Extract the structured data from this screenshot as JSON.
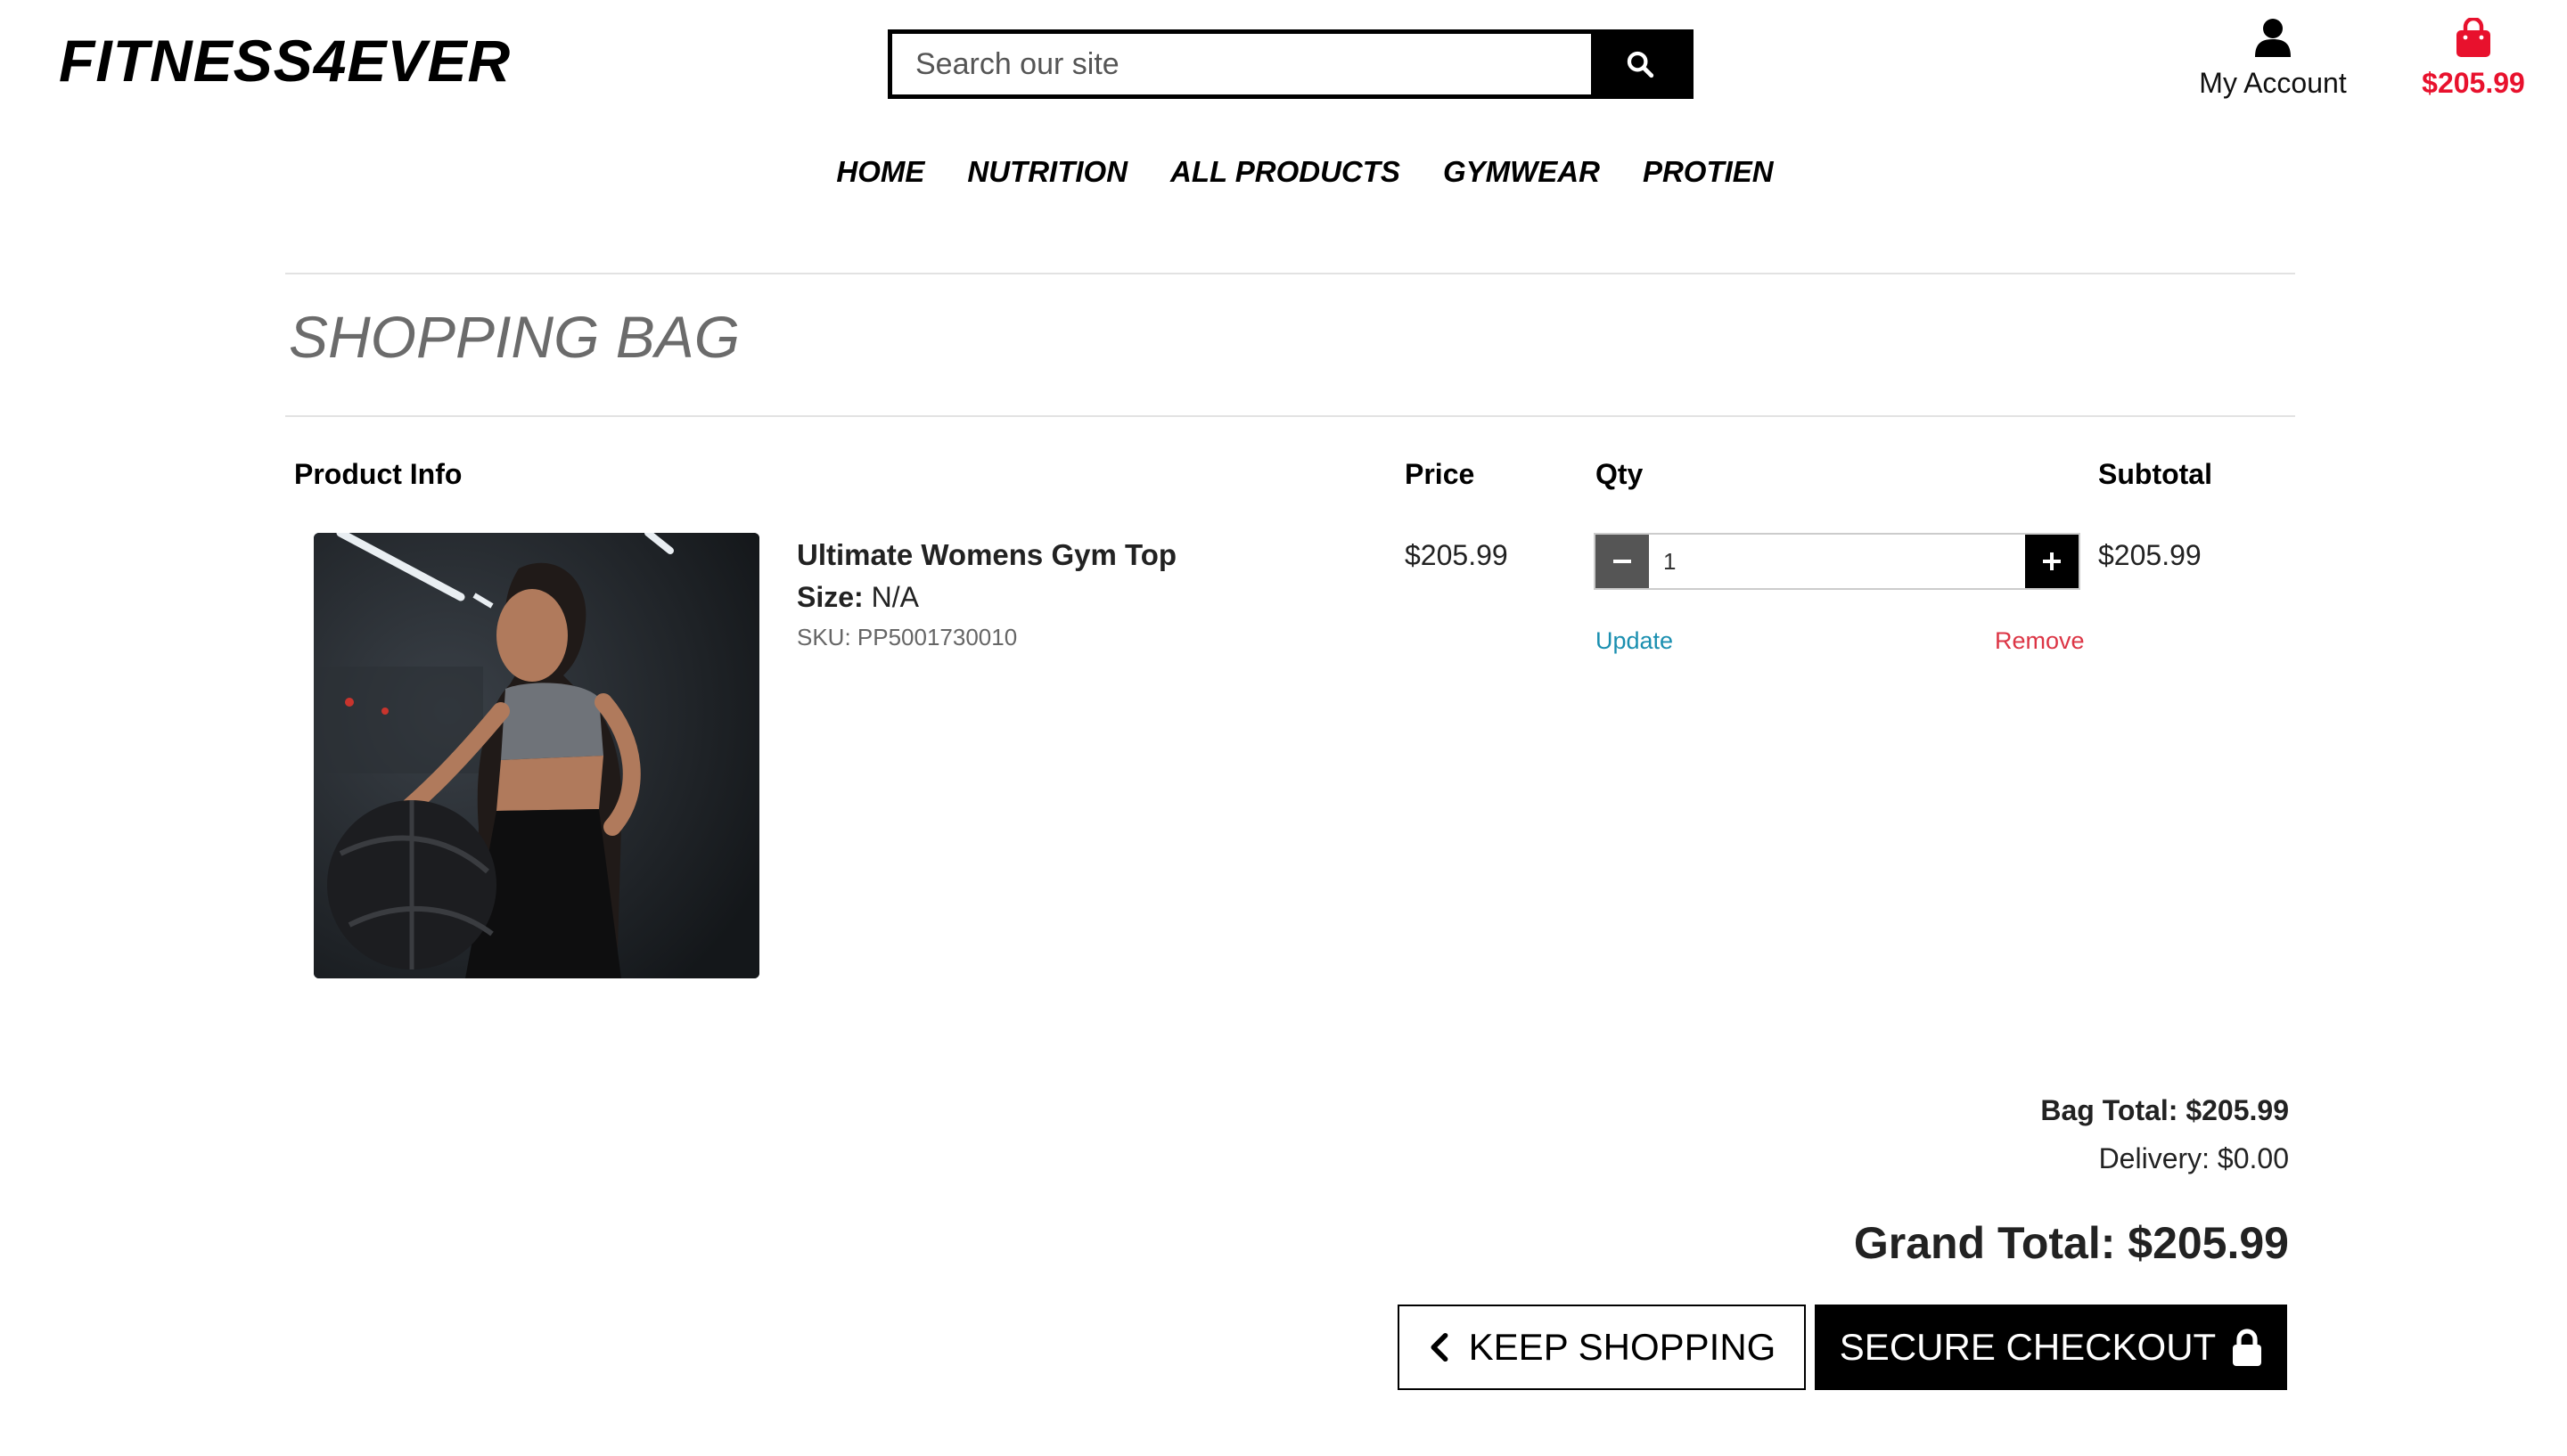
{
  "header": {
    "logo": "FITNESS4EVER",
    "search_placeholder": "Search our site",
    "account_label": "My Account",
    "bag_total": "$205.99"
  },
  "nav": {
    "items": [
      "HOME",
      "NUTRITION",
      "ALL PRODUCTS",
      "GYMWEAR",
      "PROTIEN"
    ]
  },
  "page": {
    "title": "SHOPPING BAG"
  },
  "table": {
    "headers": {
      "product": "Product Info",
      "price": "Price",
      "qty": "Qty",
      "subtotal": "Subtotal"
    }
  },
  "item": {
    "name": "Ultimate Womens Gym Top",
    "size_label": "Size:",
    "size_value": "N/A",
    "sku": "SKU: PP5001730010",
    "price": "$205.99",
    "quantity": "1",
    "update_label": "Update",
    "remove_label": "Remove",
    "subtotal": "$205.99"
  },
  "totals": {
    "bag_total": "Bag Total: $205.99",
    "delivery": "Delivery: $0.00",
    "grand_total": "Grand Total: $205.99"
  },
  "actions": {
    "keep_shopping": "KEEP SHOPPING",
    "secure_checkout": "SECURE CHECKOUT"
  },
  "colors": {
    "accent_red": "#e8112d",
    "link_blue": "#1a8fb0",
    "remove_red": "#dc3545"
  }
}
